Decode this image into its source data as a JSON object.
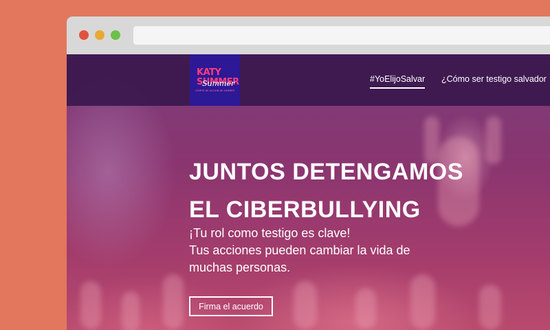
{
  "browser": {
    "window_buttons": [
      "close",
      "minimize",
      "maximize"
    ],
    "url": ""
  },
  "site": {
    "logo": {
      "line1": "KATY",
      "line2": "SUMMER",
      "script": "Summer",
      "tagline": "COMITÉ DE ACCIÓN DE SUMMER"
    },
    "nav": {
      "items": [
        {
          "label": "#YoElijoSalvar",
          "active": true
        },
        {
          "label": "¿Cómo ser testigo salvador",
          "active": false
        }
      ]
    },
    "hero": {
      "title_line1": "JUNTOS DETENGAMOS",
      "title_line2": "EL CIBERBULLYING",
      "sub_line1": "¡Tu rol como  testigo  es clave!",
      "sub_line2": "Tus acciones pueden cambiar la vida de",
      "sub_line3": "muchas personas.",
      "cta_label": "Firma el acuerdo"
    }
  },
  "colors": {
    "page_background": "#e3775d",
    "browser_chrome": "#d9d8d8",
    "navbar": "#3a184e",
    "logo_bg": "#2d1896",
    "logo_accent": "#ff3d7a"
  }
}
